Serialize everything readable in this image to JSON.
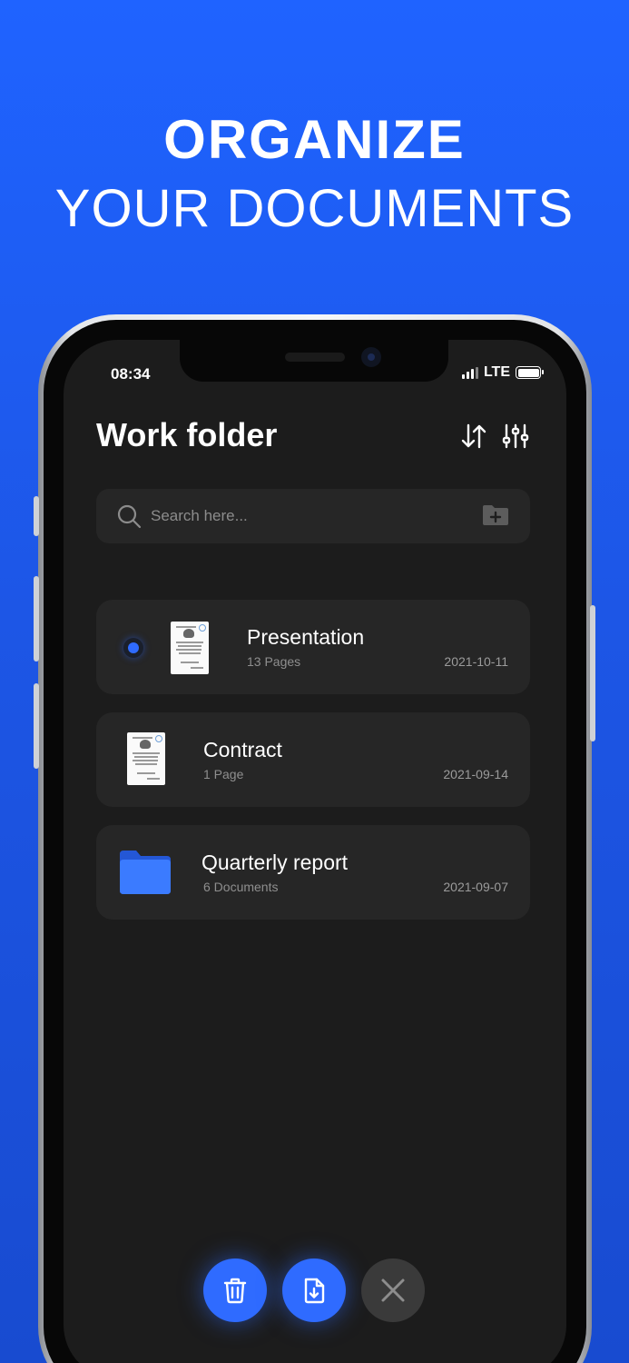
{
  "headline": {
    "line1": "ORGANIZE",
    "line2": "YOUR DOCUMENTS"
  },
  "status_bar": {
    "time": "08:34",
    "network": "LTE"
  },
  "header": {
    "title": "Work folder"
  },
  "search": {
    "placeholder": "Search here..."
  },
  "items": [
    {
      "name": "Presentation",
      "meta": "13 Pages",
      "date": "2021-10-11",
      "type": "document",
      "selected": true
    },
    {
      "name": "Contract",
      "meta": "1 Page",
      "date": "2021-09-14",
      "type": "document",
      "selected": false
    },
    {
      "name": "Quarterly report",
      "meta": "6 Documents",
      "date": "2021-09-07",
      "type": "folder",
      "selected": false
    }
  ],
  "icons": {
    "sort": "sort-icon",
    "filter": "filter-icon",
    "search": "search-icon",
    "add_folder": "add-folder-icon",
    "delete": "trash-icon",
    "export": "file-download-icon",
    "close": "close-icon"
  },
  "colors": {
    "accent": "#2f6bff",
    "background": "#1f63ff",
    "screen": "#1c1c1c",
    "card": "#262626",
    "folder": "#3b7bff"
  }
}
